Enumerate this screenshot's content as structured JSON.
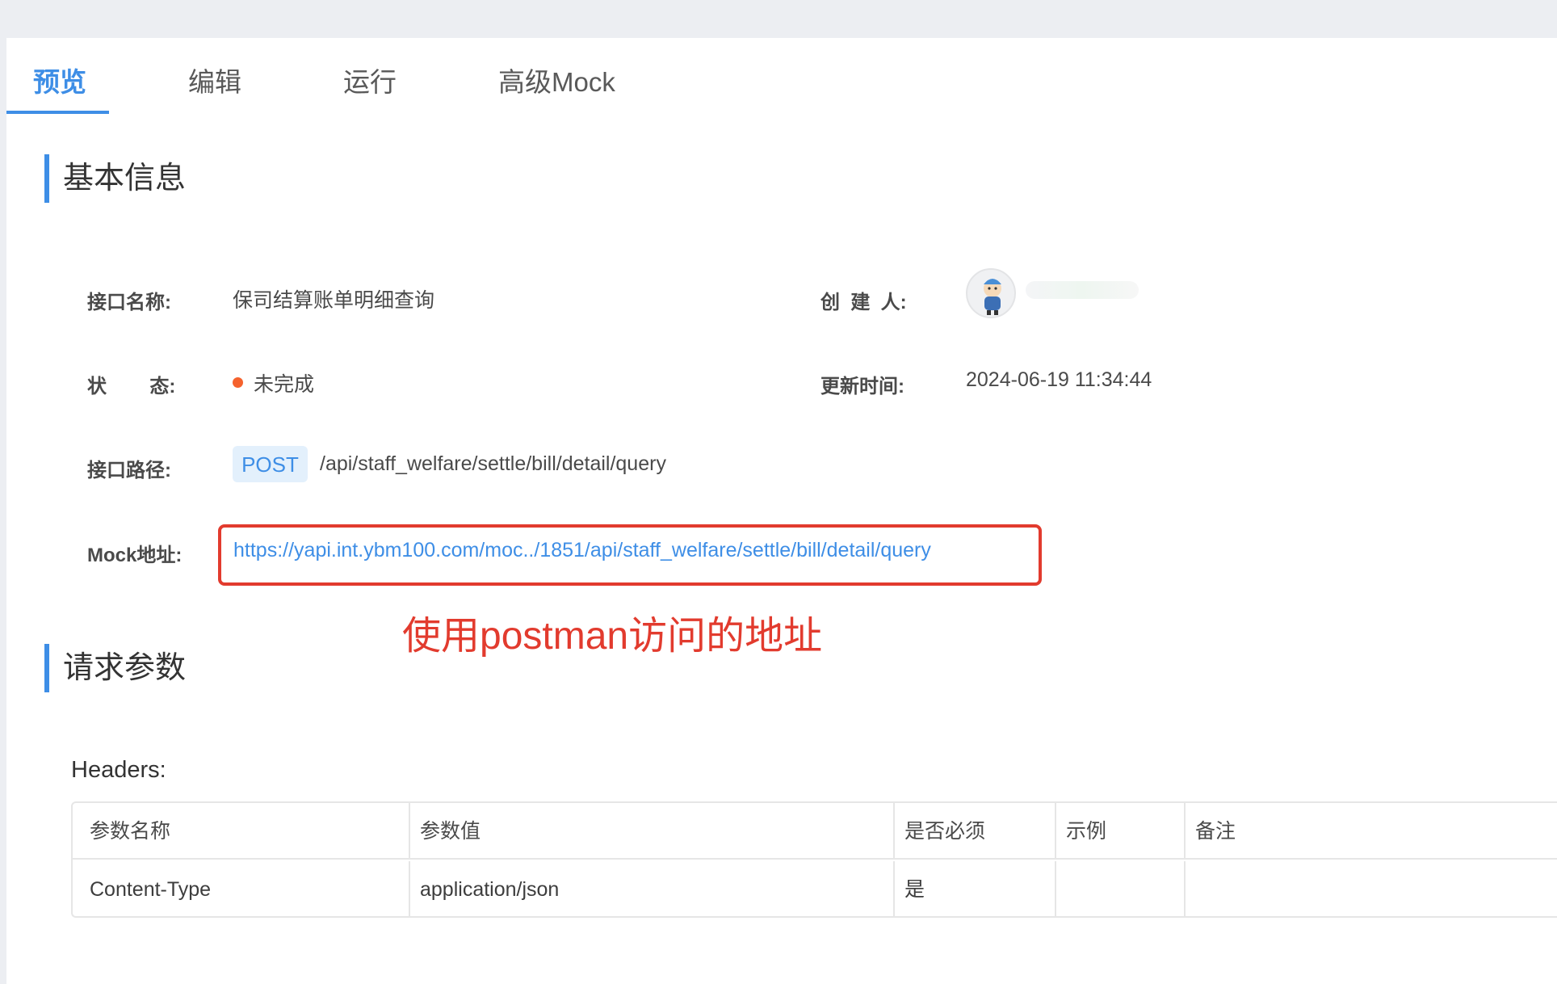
{
  "tabs": [
    {
      "label": "预览",
      "active": true
    },
    {
      "label": "编辑",
      "active": false
    },
    {
      "label": "运行",
      "active": false
    },
    {
      "label": "高级Mock",
      "active": false
    }
  ],
  "basic_info": {
    "title": "基本信息",
    "name_label": "接口名称:",
    "name_value": "保司结算账单明细查询",
    "creator_label": "创  建  人:",
    "creator_value": "",
    "status_label": "状        态:",
    "status_value": "未完成",
    "status_color": "#f5622d",
    "updated_label": "更新时间:",
    "updated_value": "2024-06-19 11:34:44",
    "path_label": "接口路径:",
    "method": "POST",
    "path_value": "/api/staff_welfare/settle/bill/detail/query",
    "mock_label": "Mock地址:",
    "mock_value": "https://yapi.int.ybm100.com/moc../1851/api/staff_welfare/settle/bill/detail/query"
  },
  "annotation": "使用postman访问的地址",
  "request_params": {
    "title": "请求参数",
    "headers_label": "Headers:",
    "columns": [
      "参数名称",
      "参数值",
      "是否必须",
      "示例",
      "备注"
    ],
    "rows": [
      [
        "Content-Type",
        "application/json",
        "是",
        "",
        ""
      ]
    ]
  },
  "colors": {
    "accent": "#3e8ee6",
    "highlight_box": "#e23b2e",
    "status_dot": "#f5622d"
  }
}
